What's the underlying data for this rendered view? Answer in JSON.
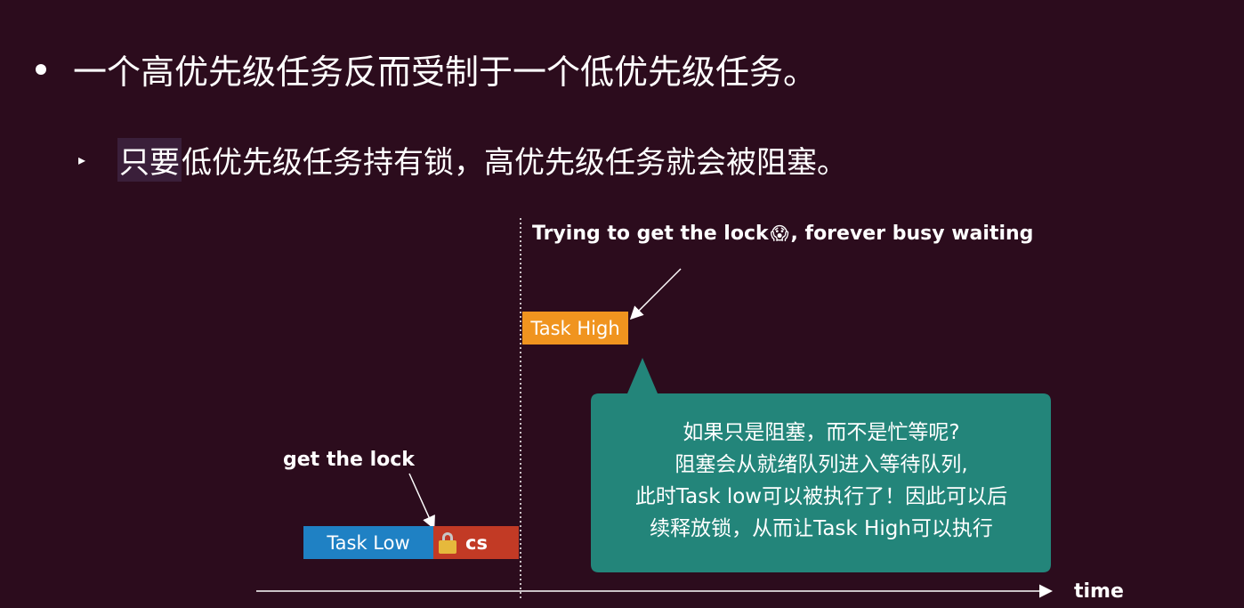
{
  "bullets": {
    "level1": "一个高优先级任务反而受制于一个低优先级任务。",
    "level2_highlight": "只要",
    "level2_rest": "低优先级任务持有锁，高优先级任务就会被阻塞。"
  },
  "diagram": {
    "top_label_before": "Trying to get the lock",
    "top_label_emoji": "😱",
    "top_label_after": ", forever busy waiting",
    "task_high": "Task High",
    "task_low": "Task Low",
    "cs": "cs",
    "get_lock": "get the lock",
    "time": "time",
    "callout_lines": [
      "如果只是阻塞，而不是忙等呢?",
      "阻塞会从就绪队列进入等待队列,",
      "此时Task low可以被执行了！因此可以后",
      "续释放锁，从而让Task High可以执行"
    ]
  },
  "colors": {
    "background": "#2c0c1d",
    "task_high": "#f0941f",
    "task_low": "#1f81c4",
    "cs": "#c23a25",
    "callout": "#23857a",
    "highlight": "#3a1f3a"
  },
  "icons": [
    "bullet-dot-icon",
    "triangle-bullet-icon",
    "screaming-face-icon",
    "lock-icon",
    "arrow-icon"
  ]
}
